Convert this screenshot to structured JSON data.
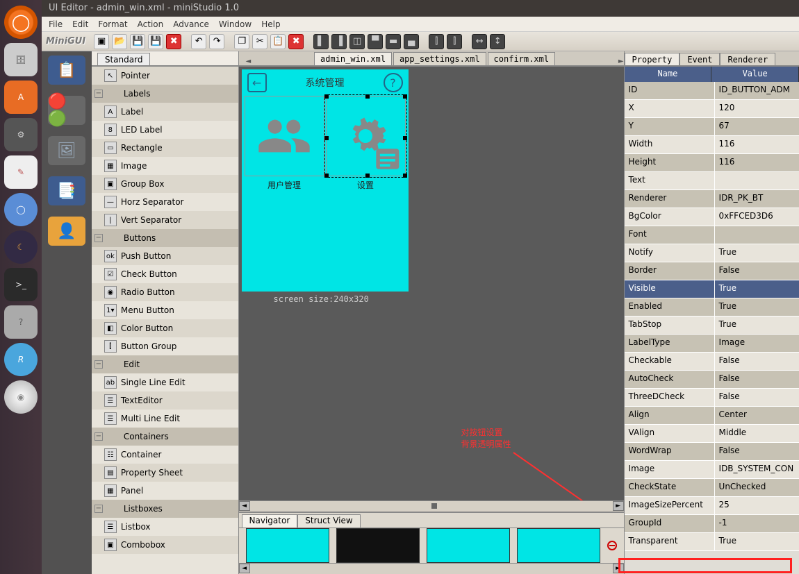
{
  "titlebar": "UI Editor - admin_win.xml - miniStudio 1.0",
  "menubar": [
    "File",
    "Edit",
    "Format",
    "Action",
    "Advance",
    "Window",
    "Help"
  ],
  "toolbar_logo": "MiniGUI",
  "palette_tab": "Standard",
  "palette": [
    {
      "type": "item",
      "label": "Pointer",
      "icon": "↖"
    },
    {
      "type": "category",
      "label": "Labels"
    },
    {
      "type": "item",
      "label": "Label",
      "icon": "A"
    },
    {
      "type": "item",
      "label": "LED Label",
      "icon": "8"
    },
    {
      "type": "item",
      "label": "Rectangle",
      "icon": "▭"
    },
    {
      "type": "item",
      "label": "Image",
      "icon": "▦"
    },
    {
      "type": "item",
      "label": "Group Box",
      "icon": "▣"
    },
    {
      "type": "item",
      "label": "Horz Separator",
      "icon": "—"
    },
    {
      "type": "item",
      "label": "Vert Separator",
      "icon": "|"
    },
    {
      "type": "category",
      "label": "Buttons"
    },
    {
      "type": "item",
      "label": "Push Button",
      "icon": "ok"
    },
    {
      "type": "item",
      "label": "Check Button",
      "icon": "☑"
    },
    {
      "type": "item",
      "label": "Radio Button",
      "icon": "◉"
    },
    {
      "type": "item",
      "label": "Menu Button",
      "icon": "1▾"
    },
    {
      "type": "item",
      "label": "Color Button",
      "icon": "◧"
    },
    {
      "type": "item",
      "label": "Button Group",
      "icon": "⫿"
    },
    {
      "type": "category",
      "label": "Edit"
    },
    {
      "type": "item",
      "label": "Single Line Edit",
      "icon": "ab"
    },
    {
      "type": "item",
      "label": "TextEditor",
      "icon": "☰"
    },
    {
      "type": "item",
      "label": "Multi Line Edit",
      "icon": "☰"
    },
    {
      "type": "category",
      "label": "Containers"
    },
    {
      "type": "item",
      "label": "Container",
      "icon": "☷"
    },
    {
      "type": "item",
      "label": "Property Sheet",
      "icon": "▤"
    },
    {
      "type": "item",
      "label": "Panel",
      "icon": "▦"
    },
    {
      "type": "category",
      "label": "Listboxes"
    },
    {
      "type": "item",
      "label": "Listbox",
      "icon": "☰"
    },
    {
      "type": "item",
      "label": "Combobox",
      "icon": "▣"
    }
  ],
  "editor_tabs": [
    {
      "label": "admin_win.xml",
      "active": true
    },
    {
      "label": "app_settings.xml",
      "active": false
    },
    {
      "label": "confirm.xml",
      "active": false
    }
  ],
  "mock_ui": {
    "title": "系统管理",
    "btn1_label": "用户管理",
    "btn2_label": "设置",
    "screen_size": "screen size:240x320"
  },
  "annotation": {
    "line1": "对按钮设置",
    "line2": "背景透明属性"
  },
  "nav_tabs": [
    {
      "label": "Navigator",
      "active": true
    },
    {
      "label": "Struct View",
      "active": false
    }
  ],
  "prop_tabs": [
    {
      "label": "Property",
      "active": true
    },
    {
      "label": "Event",
      "active": false
    },
    {
      "label": "Renderer",
      "active": false
    }
  ],
  "prop_header": {
    "name": "Name",
    "value": "Value"
  },
  "properties": [
    {
      "name": "ID",
      "value": "ID_BUTTON_ADM"
    },
    {
      "name": "X",
      "value": "120"
    },
    {
      "name": "Y",
      "value": "67"
    },
    {
      "name": "Width",
      "value": "116"
    },
    {
      "name": "Height",
      "value": "116"
    },
    {
      "name": "Text",
      "value": ""
    },
    {
      "name": "Renderer",
      "value": "IDR_PK_BT"
    },
    {
      "name": "BgColor",
      "value": "0xFFCED3D6"
    },
    {
      "name": "Font",
      "value": ""
    },
    {
      "name": "Notify",
      "value": "True"
    },
    {
      "name": "Border",
      "value": "False"
    },
    {
      "name": "Visible",
      "value": "True",
      "selected": true
    },
    {
      "name": "Enabled",
      "value": "True"
    },
    {
      "name": "TabStop",
      "value": "True"
    },
    {
      "name": "LabelType",
      "value": "Image"
    },
    {
      "name": "Checkable",
      "value": "False"
    },
    {
      "name": "AutoCheck",
      "value": "False"
    },
    {
      "name": "ThreeDCheck",
      "value": "False"
    },
    {
      "name": "Align",
      "value": "Center"
    },
    {
      "name": "VAlign",
      "value": "Middle"
    },
    {
      "name": "WordWrap",
      "value": "False"
    },
    {
      "name": "Image",
      "value": "IDB_SYSTEM_CON"
    },
    {
      "name": "CheckState",
      "value": "UnChecked"
    },
    {
      "name": "ImageSizePercent",
      "value": "25"
    },
    {
      "name": "GroupId",
      "value": "-1"
    },
    {
      "name": "Transparent",
      "value": "True",
      "highlight": true
    }
  ]
}
